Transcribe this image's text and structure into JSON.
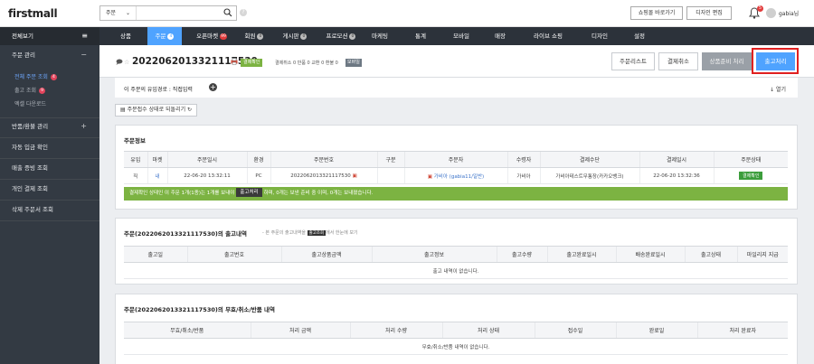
{
  "brand": {
    "logo": "firstmall"
  },
  "search": {
    "select_value": "주문",
    "placeholder": ""
  },
  "top_buttons": {
    "shopping": "쇼핑몰 바로가기",
    "design": "디자인 편집"
  },
  "notifications": {
    "count": "5"
  },
  "user": {
    "name": "gabia님"
  },
  "sidebar": {
    "header": "전체보기",
    "groups": [
      {
        "label": "주문 관리",
        "sign": "−"
      },
      {
        "label": "반품/환불 관리",
        "sign": "+"
      },
      {
        "label": "자동 입금 확인"
      },
      {
        "label": "매출 증빙 조회"
      },
      {
        "label": "개인 결제 조회"
      },
      {
        "label": "삭제 주문서 조회"
      }
    ],
    "sub_items": [
      {
        "label": "전체 주문 조회",
        "badge": "4"
      },
      {
        "label": "출고 조회",
        "badge": "9"
      },
      {
        "label": "엑셀 다운로드"
      }
    ]
  },
  "tabs": [
    {
      "label": "상품"
    },
    {
      "label": "주문",
      "badge": "4"
    },
    {
      "label": "오픈마켓",
      "badge": "99"
    },
    {
      "label": "회원",
      "badge": "0"
    },
    {
      "label": "게시판",
      "badge": "0"
    },
    {
      "label": "프로모션",
      "badge": "0"
    },
    {
      "label": "마케팅"
    },
    {
      "label": "통계"
    },
    {
      "label": "모바일"
    },
    {
      "label": "매장"
    },
    {
      "label": "라이브 쇼핑"
    },
    {
      "label": "디자인"
    },
    {
      "label": "설정"
    }
  ],
  "order": {
    "number": "2022062013321117530",
    "status": "결제확인",
    "counts": "결제취소 0   반품 0   교환 0   환불 0",
    "channel": "모바일",
    "buttons": {
      "list": "주문리스트",
      "cancel": "결제취소",
      "ready": "상품준비 처리",
      "ship": "출고처리"
    }
  },
  "inflow": {
    "label": "이 주문의 유입경로 : 직접입력",
    "fold": "↓ 열기"
  },
  "restore_button": "주문접수 상태로 되돌리기",
  "order_info": {
    "title": "주문정보",
    "headers": [
      "유입",
      "마켓",
      "주문일시",
      "환경",
      "주문번호",
      "구분",
      "주문자",
      "수령자",
      "결제수단",
      "결제일시",
      "주문상태"
    ],
    "row": [
      "직",
      "내",
      "22-06-20 13:32:11",
      "PC",
      "2022062013321117530",
      "",
      "가비아 (gabia11/일반)",
      "가비아",
      "가비아테스트무통장(카카오뱅크)",
      "22-06-20 13:32:36",
      "결제확인"
    ],
    "notice_before": "결제확인 상태인 이 주문 1개(1종)는 1개를 보내야",
    "notice_chip": "출고처리",
    "notice_after": "하며, 0개는 보낸 준비 중 이며, 0개는 보내졌습니다."
  },
  "shipment": {
    "title": "주문(2022062013321117530)의 출고내역",
    "note_before": "- 본 주문의 출고내역을",
    "note_chip": "출고조회",
    "note_after": "에서 한눈에 보기",
    "headers": [
      "출고일",
      "출고번호",
      "출고상품금액",
      "출고정보",
      "출고수량",
      "출고완료일시",
      "배송완료일시",
      "출고상태",
      "마일리지 지급"
    ],
    "empty": "출고 내역이 없습니다."
  },
  "refund": {
    "title": "주문(2022062013321117530)의 무효/취소/반품 내역",
    "headers": [
      "무효/취소/반품",
      "처리 금액",
      "처리 수량",
      "처리 상태",
      "접수일",
      "완료일",
      "처리 완료자"
    ],
    "empty": "무효/취소/반품 내역이 없습니다."
  }
}
